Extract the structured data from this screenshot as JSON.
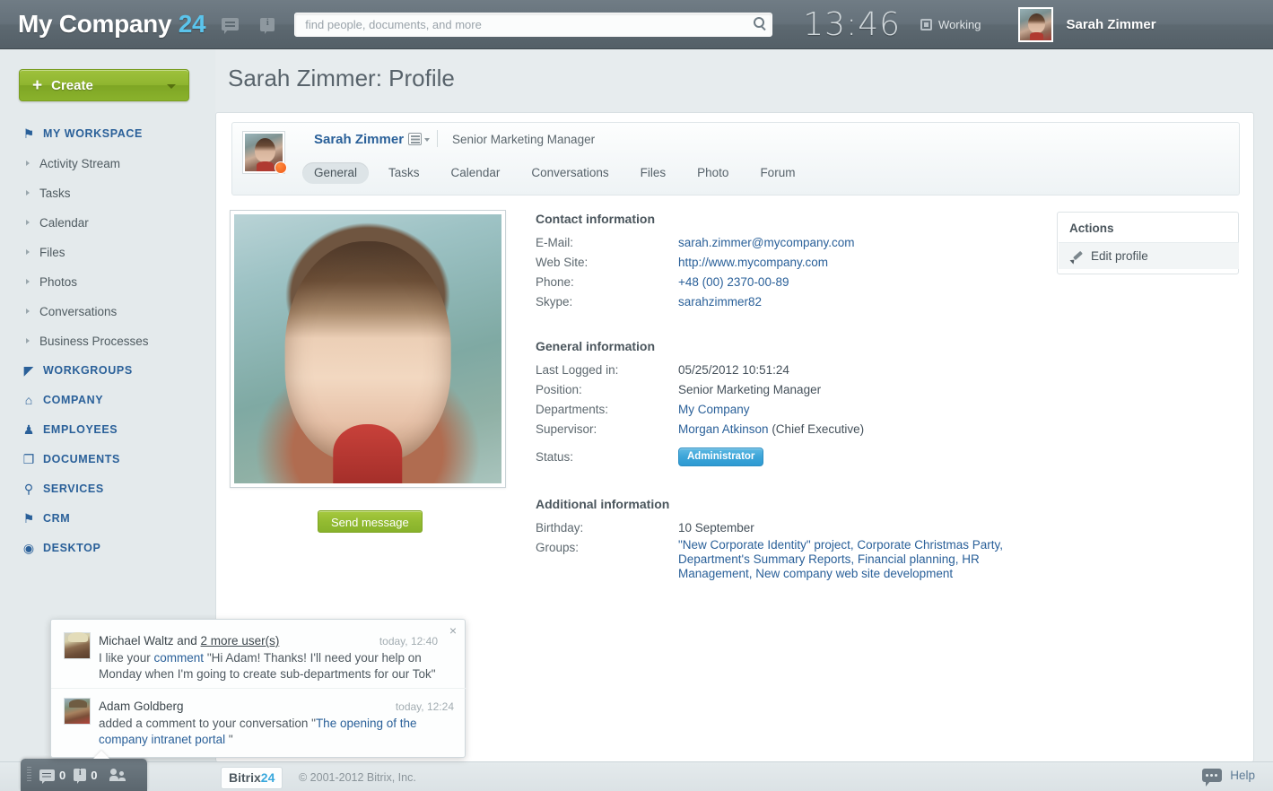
{
  "header": {
    "logo_text": "My Company",
    "logo_number": "24",
    "chat_icon": "chat-bubble-icon",
    "info_icon": "info-icon",
    "search_placeholder": "find people, documents, and more",
    "search_value": "",
    "search_icon": "search-icon",
    "clock": "13:46",
    "status_label": "Working",
    "user_name": "Sarah Zimmer"
  },
  "sidebar": {
    "create_button": {
      "plus": "+",
      "label": "Create",
      "caret": "chevron-down-icon"
    },
    "sections": [
      {
        "label": "MY WORKSPACE",
        "icon": "bookmark-icon",
        "glyph": "⚑",
        "items": [
          "Activity Stream",
          "Tasks",
          "Calendar",
          "Files",
          "Photos",
          "Conversations",
          "Business Processes"
        ]
      },
      {
        "label": "WORKGROUPS",
        "icon": "megaphone-icon",
        "glyph": "◤",
        "items": []
      },
      {
        "label": "COMPANY",
        "icon": "home-icon",
        "glyph": "⌂",
        "items": []
      },
      {
        "label": "EMPLOYEES",
        "icon": "people-icon",
        "glyph": "♟",
        "items": []
      },
      {
        "label": "DOCUMENTS",
        "icon": "documents-icon",
        "glyph": "❐",
        "items": []
      },
      {
        "label": "SERVICES",
        "icon": "lightbulb-icon",
        "glyph": "⚲",
        "items": []
      },
      {
        "label": "CRM",
        "icon": "flag-icon",
        "glyph": "⚑",
        "items": []
      },
      {
        "label": "DESKTOP",
        "icon": "circle-icon",
        "glyph": "◉",
        "items": []
      }
    ]
  },
  "page": {
    "title": "Sarah Zimmer: Profile"
  },
  "profile_header": {
    "name": "Sarah Zimmer",
    "menu_icon": "list-menu-icon",
    "caret_icon": "chevron-down-icon",
    "position": "Senior Marketing Manager",
    "status_dot": "online-status-dot",
    "tabs": [
      {
        "label": "General",
        "active": true
      },
      {
        "label": "Tasks",
        "active": false
      },
      {
        "label": "Calendar",
        "active": false
      },
      {
        "label": "Conversations",
        "active": false
      },
      {
        "label": "Files",
        "active": false
      },
      {
        "label": "Photo",
        "active": false
      },
      {
        "label": "Forum",
        "active": false
      }
    ]
  },
  "photo": {
    "alt": "profile-photo",
    "send_message_label": "Send message"
  },
  "contact_information": {
    "title": "Contact information",
    "fields": [
      {
        "label": "E-Mail:",
        "value": "sarah.zimmer@mycompany.com",
        "link": true
      },
      {
        "label": "Web Site:",
        "value": "http://www.mycompany.com",
        "link": true
      },
      {
        "label": "Phone:",
        "value": "+48 (00) 2370-00-89",
        "link": true
      },
      {
        "label": "Skype:",
        "value": "sarahzimmer82",
        "link": true
      }
    ]
  },
  "general_information": {
    "title": "General information",
    "last_logged_label": "Last Logged in:",
    "last_logged_value": "05/25/2012 10:51:24",
    "position_label": "Position:",
    "position_value": "Senior Marketing Manager",
    "departments_label": "Departments:",
    "departments_value": "My Company",
    "supervisor_label": "Supervisor:",
    "supervisor_name": "Morgan Atkinson",
    "supervisor_role": " (Chief Executive)",
    "status_label": "Status:",
    "status_badge": "Administrator"
  },
  "additional_information": {
    "title": "Additional information",
    "birthday_label": "Birthday:",
    "birthday_value": "10 September",
    "groups_label": "Groups:",
    "groups_value": "\"New Corporate Identity\" project, Corporate Christmas Party, Department's Summary Reports, Financial planning, HR Management, New company web site development"
  },
  "actions": {
    "title": "Actions",
    "edit_profile_label": "Edit profile",
    "pencil_icon": "pencil-icon"
  },
  "notifications": {
    "close_icon": "×",
    "items": [
      {
        "name": "Michael Waltz and ",
        "more_link": "2 more user(s)",
        "time": "today, 12:40",
        "body_pre": "I like your ",
        "body_link": "comment",
        "body_post": " \"Hi Adam! Thanks! I'll need your help on Monday when I'm going to create sub-departments for our Tok\""
      },
      {
        "name": "Adam Goldberg",
        "more_link": "",
        "time": "today, 12:24",
        "body_pre": "added a comment to your conversation \"",
        "body_link": "The opening of the company intranet portal",
        "body_post": " \""
      }
    ]
  },
  "bottom_bar": {
    "messages_count": "0",
    "notifications_count": "0",
    "people_icon": "people-icon",
    "bitrix_logo_text": "Bitrix",
    "bitrix_logo_number": "24",
    "copyright": "© 2001-2012 Bitrix, Inc.",
    "help_label": "Help",
    "help_icon": "help-chat-icon"
  },
  "colors": {
    "accent_blue": "#2a6099",
    "brand_cyan": "#5bc4ec",
    "green_button": "#8fb52f",
    "status_badge_blue": "#3ba4d8",
    "header_gray": "#5d6971"
  }
}
